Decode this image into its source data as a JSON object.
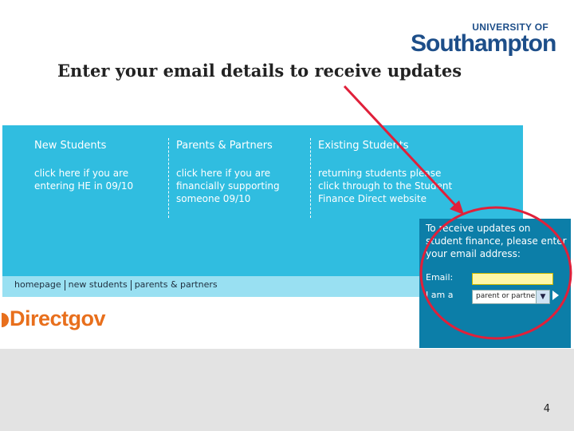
{
  "logo": {
    "line1": "UNIVERSITY OF",
    "line2": "Southampton"
  },
  "headline": "Enter your email details to receive updates",
  "columns": [
    {
      "title": "New Students",
      "text": "click here if you are entering HE in 09/10"
    },
    {
      "title": "Parents & Partners",
      "text": "click here if you are financially supporting someone 09/10"
    },
    {
      "title": "Existing Students",
      "text": "returning students please click through to the Student Finance Direct website"
    }
  ],
  "nav": {
    "links": [
      "homepage",
      "new students",
      "parents & partners"
    ]
  },
  "directgov": "Directgov",
  "signup": {
    "prompt": "To receive updates on student finance, please enter your email address:",
    "email_label": "Email:",
    "email_value": "",
    "iam_label": "I am a",
    "select_value": "parent or partne"
  },
  "slide_number": "4",
  "colors": {
    "panel": "#30bde0",
    "navbar": "#99e0f2",
    "signup_box": "#0c7ea8",
    "annotation": "#e0203a",
    "brand": "#1d4e89",
    "directgov": "#e86f1c"
  },
  "icons": {
    "select_arrow": "chevron-down-icon",
    "submit": "play-arrow-icon",
    "directgov_mark": "directgov-mark-icon"
  }
}
